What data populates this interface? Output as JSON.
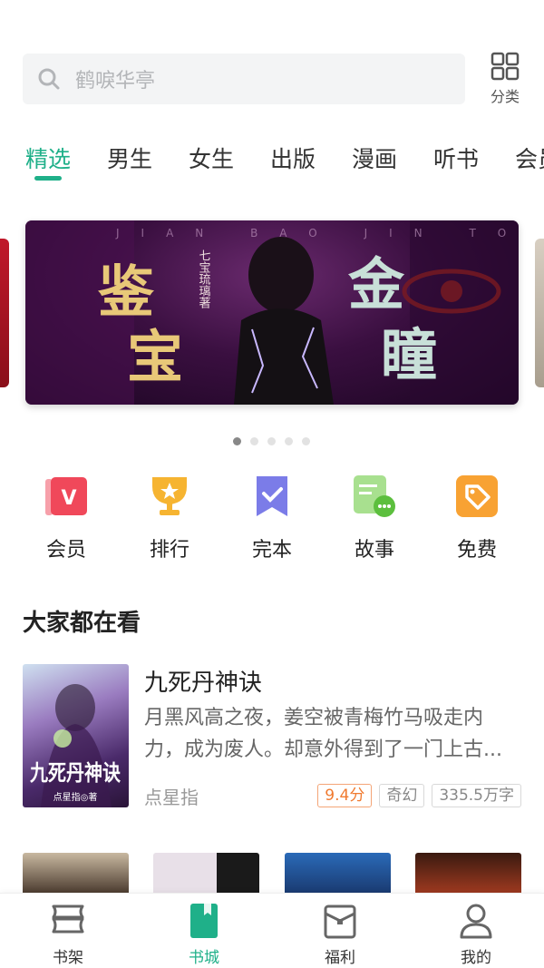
{
  "search": {
    "placeholder": "鹤唳华亭",
    "category_label": "分类"
  },
  "tabs": [
    {
      "label": "精选",
      "active": true
    },
    {
      "label": "男生"
    },
    {
      "label": "女生"
    },
    {
      "label": "出版"
    },
    {
      "label": "漫画"
    },
    {
      "label": "听书"
    },
    {
      "label": "会员"
    }
  ],
  "banner": {
    "title_left_1": "鉴",
    "title_left_2": "宝",
    "title_right_1": "金",
    "title_right_2": "瞳",
    "author_vertical": "七宝琉璃著",
    "pinyin": "JIAN BAO JIN TONG",
    "dots_total": 5,
    "dots_active": 0
  },
  "quick_entries": [
    {
      "label": "会员",
      "icon": "vip-card-icon",
      "color": "#f0485a"
    },
    {
      "label": "排行",
      "icon": "trophy-icon",
      "color": "#f6b431"
    },
    {
      "label": "完本",
      "icon": "bookmark-check-icon",
      "color": "#7b7ce8"
    },
    {
      "label": "故事",
      "icon": "story-chat-icon",
      "color": "#7bcf5e"
    },
    {
      "label": "免费",
      "icon": "tag-icon",
      "color": "#f8a233"
    }
  ],
  "section": {
    "title": "大家都在看"
  },
  "featured_book": {
    "title": "九死丹神诀",
    "description": "月黑风高之夜，姜空被青梅竹马吸走内力，成为废人。却意外得到了一门上古...",
    "author": "点星指",
    "score": "9.4分",
    "genre": "奇幻",
    "word_count": "335.5万字",
    "cover_text": "九死丹神诀",
    "cover_author": "点星指◎著"
  },
  "bottom_nav": [
    {
      "label": "书架",
      "icon": "bookshelf-icon"
    },
    {
      "label": "书城",
      "icon": "bookstore-icon",
      "active": true
    },
    {
      "label": "福利",
      "icon": "gift-bag-icon"
    },
    {
      "label": "我的",
      "icon": "user-icon"
    }
  ],
  "colors": {
    "accent": "#1fb089",
    "score": "#f07a2f"
  }
}
